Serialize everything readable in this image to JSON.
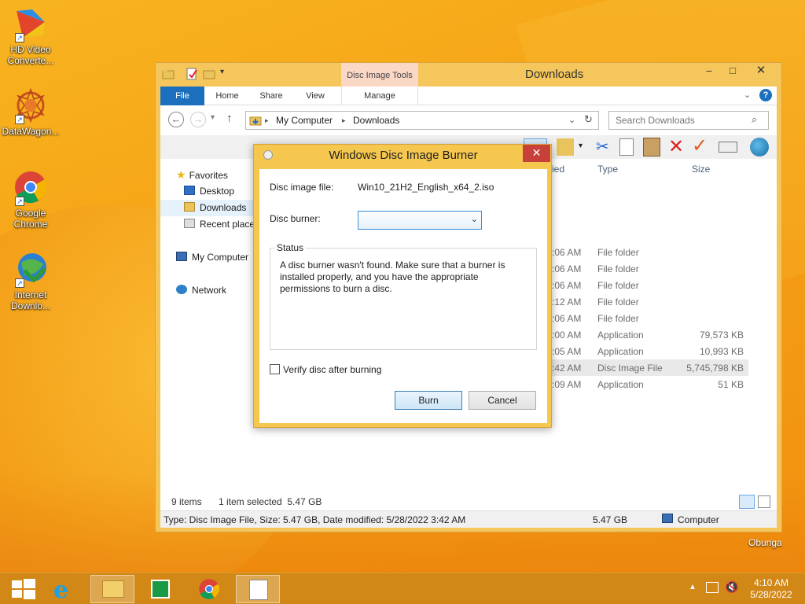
{
  "desktop": {
    "icons": [
      {
        "label": "HD Video Converte..."
      },
      {
        "label": "DataWagon..."
      },
      {
        "label": "Google Chrome"
      },
      {
        "label": "Internet Downlo..."
      }
    ],
    "user_label": "Obunga"
  },
  "explorer": {
    "title": "Downloads",
    "context_tab": "Disc Image Tools",
    "ribbon_tabs": [
      "File",
      "Home",
      "Share",
      "View",
      "Manage"
    ],
    "address": {
      "crumbs": [
        "My Computer",
        "Downloads"
      ]
    },
    "search_placeholder": "Search Downloads",
    "navpane": {
      "favorites": "Favorites",
      "items": [
        "Desktop",
        "Downloads",
        "Recent places"
      ],
      "computer": "My Computer",
      "network": "Network"
    },
    "columns": {
      "modified": "ied",
      "type": "Type",
      "size": "Size"
    },
    "rows": [
      {
        "time": ":06 AM",
        "type": "File folder",
        "size": ""
      },
      {
        "time": ":06 AM",
        "type": "File folder",
        "size": ""
      },
      {
        "time": ":06 AM",
        "type": "File folder",
        "size": ""
      },
      {
        "time": ":12 AM",
        "type": "File folder",
        "size": ""
      },
      {
        "time": ":06 AM",
        "type": "File folder",
        "size": ""
      },
      {
        "time": ":00 AM",
        "type": "Application",
        "size": "79,573 KB"
      },
      {
        "time": ":05 AM",
        "type": "Application",
        "size": "10,993 KB"
      },
      {
        "time": ":42 AM",
        "type": "Disc Image File",
        "size": "5,745,798 KB"
      },
      {
        "time": ":09 AM",
        "type": "Application",
        "size": "51 KB"
      }
    ],
    "status": {
      "count": "9 items",
      "selected": "1 item selected  5.47 GB"
    },
    "details": {
      "info": "Type: Disc Image File, Size: 5.47 GB, Date modified: 5/28/2022 3:42 AM",
      "size": "5.47 GB",
      "location": "Computer"
    }
  },
  "dialog": {
    "title": "Windows Disc Image Burner",
    "image_label": "Disc image file:",
    "image_value": "Win10_21H2_English_x64_2.iso",
    "burner_label": "Disc burner:",
    "status_label": "Status",
    "status_text": "A disc burner wasn't found. Make sure that a burner is installed properly, and you have the appropriate permissions to burn a disc.",
    "verify_label": "Verify disc after burning",
    "burn": "Burn",
    "cancel": "Cancel"
  },
  "taskbar": {
    "time": "4:10 AM",
    "date": "5/28/2022"
  },
  "colors": {
    "accent": "#1c6fbd",
    "close_red": "#c7403a",
    "window_frame": "#f4c65b"
  }
}
